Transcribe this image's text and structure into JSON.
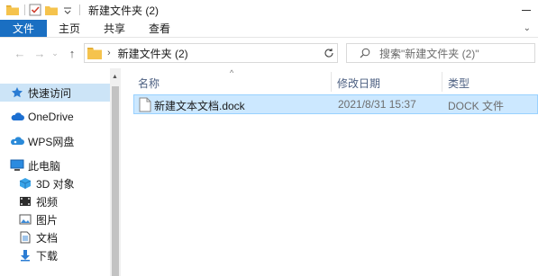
{
  "window": {
    "title": "新建文件夹 (2)"
  },
  "ribbon": {
    "tabs": [
      "文件",
      "主页",
      "共享",
      "查看"
    ]
  },
  "address": {
    "path": "新建文件夹 (2)"
  },
  "search": {
    "placeholder": "搜索\"新建文件夹 (2)\""
  },
  "sidebar": {
    "items": [
      {
        "label": "快速访问",
        "icon": "star-pin-icon"
      },
      {
        "label": "OneDrive",
        "icon": "cloud-icon"
      },
      {
        "label": "WPS网盘",
        "icon": "wps-cloud-icon"
      },
      {
        "label": "此电脑",
        "icon": "computer-icon"
      },
      {
        "label": "3D 对象",
        "icon": "cube-icon"
      },
      {
        "label": "视频",
        "icon": "video-icon"
      },
      {
        "label": "图片",
        "icon": "picture-icon"
      },
      {
        "label": "文档",
        "icon": "document-icon"
      },
      {
        "label": "下载",
        "icon": "download-icon"
      }
    ]
  },
  "columns": {
    "name": "名称",
    "modified": "修改日期",
    "type": "类型"
  },
  "files": [
    {
      "name": "新建文本文档.dock",
      "modified": "2021/8/31 15:37",
      "type": "DOCK 文件"
    }
  ],
  "colors": {
    "accent": "#1a6fc2",
    "selection": "#cce8ff",
    "nav_active": "#cce4f7",
    "folder": "#f5c34d"
  }
}
